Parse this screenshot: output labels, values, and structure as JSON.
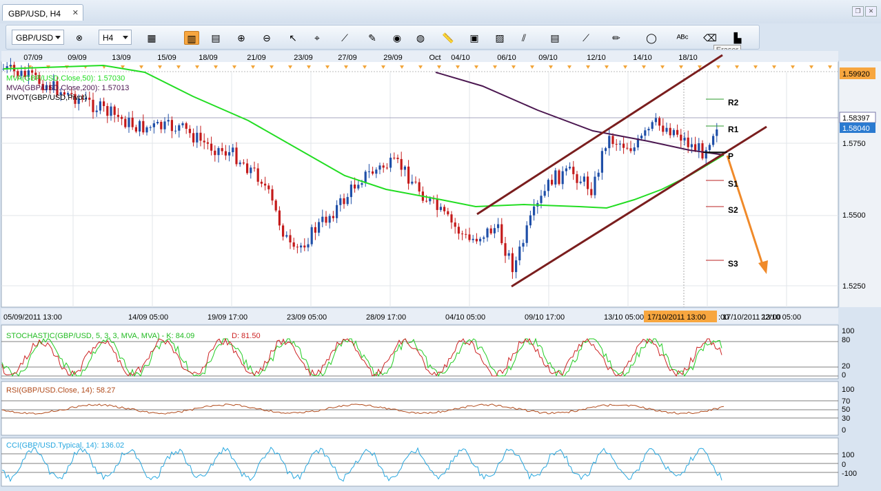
{
  "window": {
    "tab_title": "GBP/USD, H4",
    "tab_close": "✕",
    "restore": "❐",
    "close": "✕"
  },
  "toolbar": {
    "symbol": "GBP/USD",
    "period": "H4",
    "tooltip": "Eraser",
    "buttons": [
      {
        "name": "chart-type-icon",
        "g": "▦"
      },
      {
        "name": "candles-icon",
        "g": "▥",
        "active": true
      },
      {
        "name": "bars-icon",
        "g": "▤"
      },
      {
        "name": "zoom-in-icon",
        "g": "⊕"
      },
      {
        "name": "zoom-out-icon",
        "g": "⊖"
      },
      {
        "name": "cursor-icon",
        "g": "↖"
      },
      {
        "name": "crosshair-icon",
        "g": "⌖"
      },
      {
        "name": "line-icon",
        "g": "⟋"
      },
      {
        "name": "pencil-icon",
        "g": "✎"
      },
      {
        "name": "magnet-icon",
        "g": "◉"
      },
      {
        "name": "globe-icon",
        "g": "◍"
      },
      {
        "name": "ruler-icon",
        "g": "📏"
      },
      {
        "name": "image-icon",
        "g": "▣"
      },
      {
        "name": "template-icon",
        "g": "▨"
      },
      {
        "name": "fibonacci-icon",
        "g": "⫽"
      },
      {
        "name": "panel-icon",
        "g": "▤"
      },
      {
        "name": "trendline-icon",
        "g": "⟋"
      },
      {
        "name": "brush-icon",
        "g": "✏"
      },
      {
        "name": "ellipse-icon",
        "g": "◯"
      },
      {
        "name": "text-icon",
        "g": "ᴬᴮᶜ"
      },
      {
        "name": "eraser-icon",
        "g": "⌫"
      },
      {
        "name": "objects-icon",
        "g": "▙"
      }
    ]
  },
  "top_dates": [
    "07/09",
    "09/09",
    "13/09",
    "15/09",
    "18/09",
    "21/09",
    "23/09",
    "27/09",
    "29/09",
    "Oct",
    "04/10",
    "06/10",
    "09/10",
    "12/10",
    "14/10",
    "18/10"
  ],
  "bottom_dates": [
    "05/09/2011 13:00",
    "14/09 05:00",
    "19/09 17:00",
    "23/09 05:00",
    "28/09 17:00",
    "04/10 05:00",
    "09/10 17:00",
    "13/10 05:00",
    "17/10/2011 13:00",
    "22/10 05:00"
  ],
  "crosshair_label_tail": ":00",
  "prices": {
    "tag_top": "1.59920",
    "tag_current": "1.58397",
    "tag_bid": "1.58040",
    "axis": [
      "1.5750",
      "1.5500",
      "1.5250"
    ]
  },
  "legend": [
    "MVA(GBP/USD.Close,50): 1.57030",
    "MVA(GBP/USD.Close,200): 1.57013",
    "PIVOT(GBP/USD,Pivot)"
  ],
  "pivots": [
    "R2",
    "R1",
    "P",
    "S1",
    "S2",
    "S3"
  ],
  "stochastic": {
    "label": "STOCHASTIC(GBP/USD, 5, 3, 3, MVA, MVA) -  K: 84.09",
    "d": "D: 81.50",
    "levels": [
      "100",
      "80",
      "20",
      "0"
    ]
  },
  "rsi": {
    "label": "RSI(GBP/USD.Close, 14): 58.27",
    "levels": [
      "100",
      "70",
      "50",
      "30",
      "0"
    ]
  },
  "cci": {
    "label": "CCI(GBP/USD.Typical, 14): 136.02",
    "levels": [
      "100",
      "0",
      "-100"
    ]
  },
  "colors": {
    "bull": "#1f4fa8",
    "bear": "#c41a1a",
    "ma50": "#22dd22",
    "ma200": "#4b1750",
    "channel": "#7a1e1e",
    "arrow": "#f08a2a",
    "stochK": "#22cc22",
    "stochD": "#cc2222",
    "rsi": "#b04a1a",
    "cci": "#28a8e0"
  }
}
